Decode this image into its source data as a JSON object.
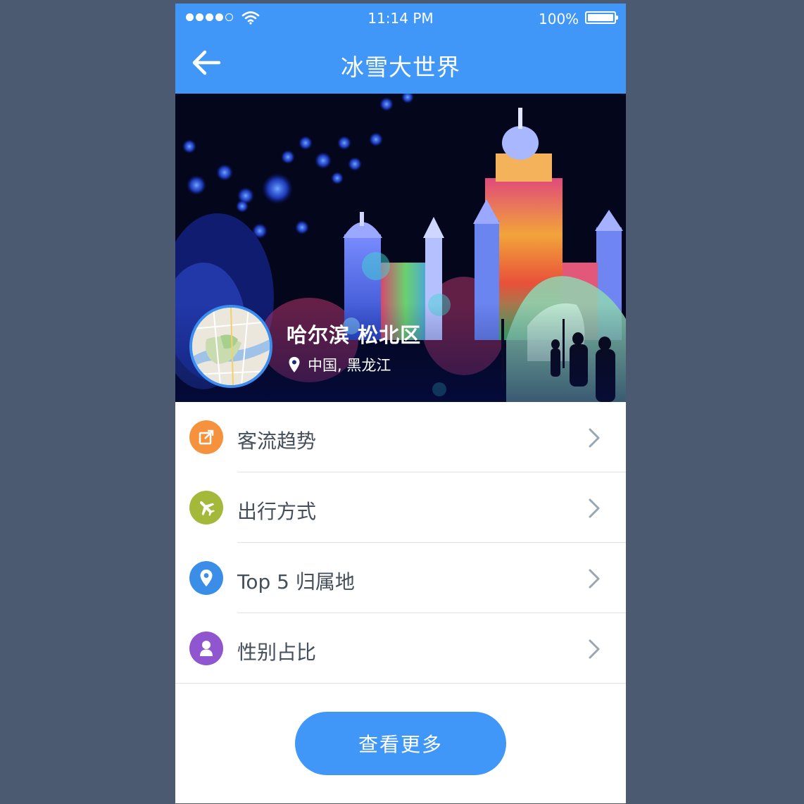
{
  "status_bar": {
    "time": "11:14 PM",
    "battery_percent": "100%",
    "signal_bars_filled": 4,
    "signal_bars_total": 5,
    "icons": [
      "signal-dots-icon",
      "wifi-icon",
      "battery-icon"
    ]
  },
  "header": {
    "title": "冰雪大世界",
    "back_icon": "arrow-left-icon"
  },
  "hero": {
    "place_name": "哈尔滨 松北区",
    "location": "中国, 黑龙江",
    "location_icon": "map-pin-icon",
    "thumbnail_icon": "map-thumbnail"
  },
  "menu": {
    "items": [
      {
        "label": "客流趋势",
        "icon": "external-edit-icon",
        "color": "#f6923e"
      },
      {
        "label": "出行方式",
        "icon": "airplane-icon",
        "color": "#a4b83a"
      },
      {
        "label": "Top 5 归属地",
        "icon": "map-pin-icon",
        "color": "#3b8ee8"
      },
      {
        "label": "性别占比",
        "icon": "person-icon",
        "color": "#9056cf"
      }
    ],
    "chevron_icon": "chevron-right-icon"
  },
  "actions": {
    "more_label": "查看更多"
  },
  "colors": {
    "primary": "#4197f7",
    "background": "#4b5a70",
    "text": "#444f5b",
    "divider": "#dfe3e7"
  }
}
